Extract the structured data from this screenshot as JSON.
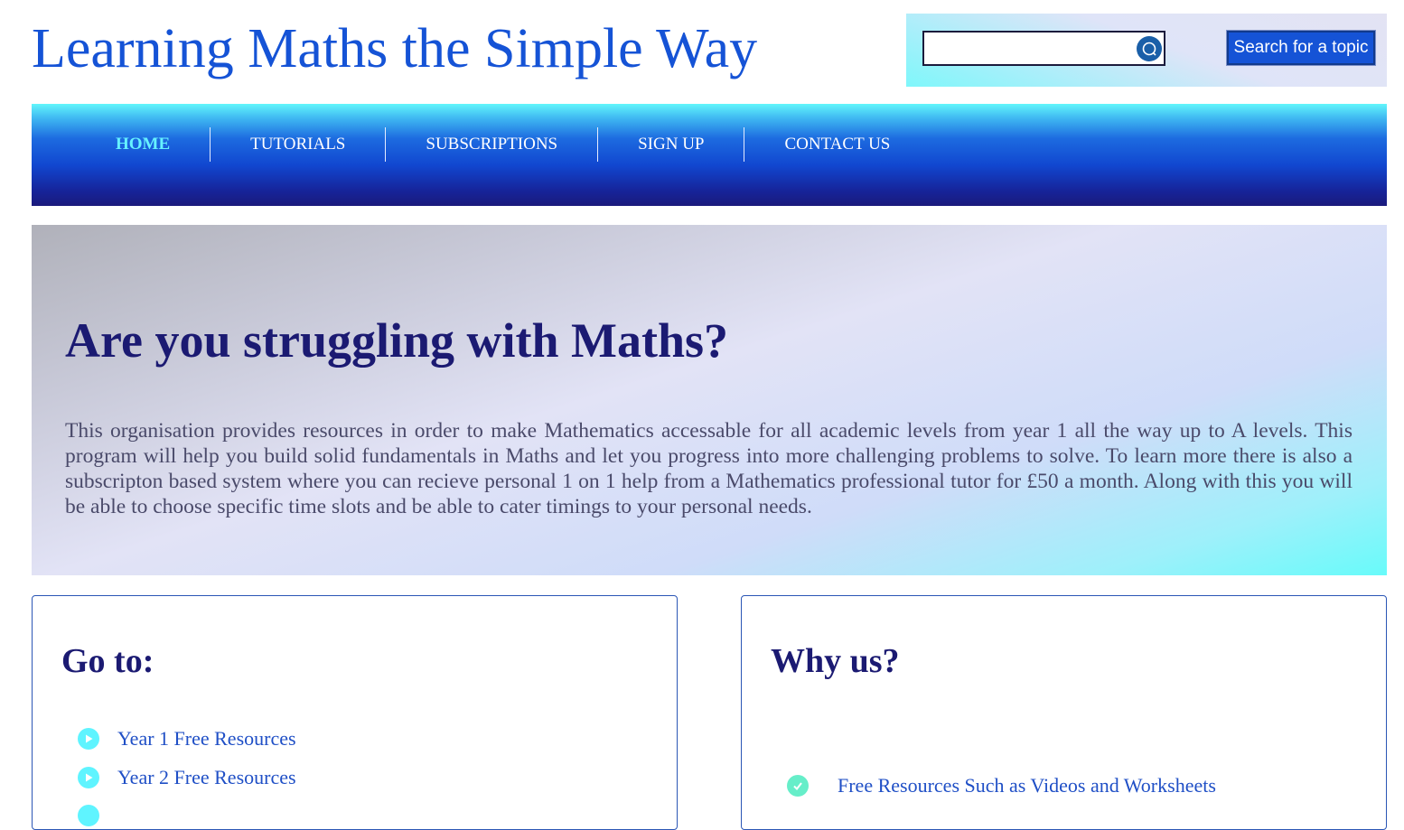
{
  "header": {
    "site_title": "Learning Maths the Simple Way",
    "search_value": "",
    "search_button_label": "Search for a topic"
  },
  "nav": {
    "items": [
      {
        "label": "HOME",
        "active": true
      },
      {
        "label": "TUTORIALS",
        "active": false
      },
      {
        "label": "SUBSCRIPTIONS",
        "active": false
      },
      {
        "label": "SIGN UP",
        "active": false
      },
      {
        "label": "CONTACT US",
        "active": false
      }
    ]
  },
  "hero": {
    "title": "Are you struggling with Maths?",
    "text": "This organisation provides resources in order to make Mathematics accessable for all academic levels from year 1 all the way up to A levels. This program will help you build solid fundamentals in Maths and let you progress into more challenging problems to solve. To learn more there is also a subscripton based system where you can recieve personal 1 on 1 help from a Mathematics professional tutor for £50 a month. Along with this you will be able to choose specific time slots and be able to cater timings to your personal needs."
  },
  "goto_panel": {
    "title": "Go to:",
    "links": [
      {
        "label": "Year 1 Free Resources",
        "icon": "play-circle-icon"
      },
      {
        "label": "Year 2 Free Resources",
        "icon": "play-circle-icon"
      }
    ]
  },
  "why_panel": {
    "title": "Why us?",
    "items": [
      {
        "label": "Free Resources Such as Videos and Worksheets",
        "icon": "check-circle-icon"
      }
    ]
  },
  "colors": {
    "brand_blue": "#1553d6",
    "navy": "#1b1a72",
    "accent_cyan": "#5ff4ff",
    "check_green": "#66eec9"
  }
}
